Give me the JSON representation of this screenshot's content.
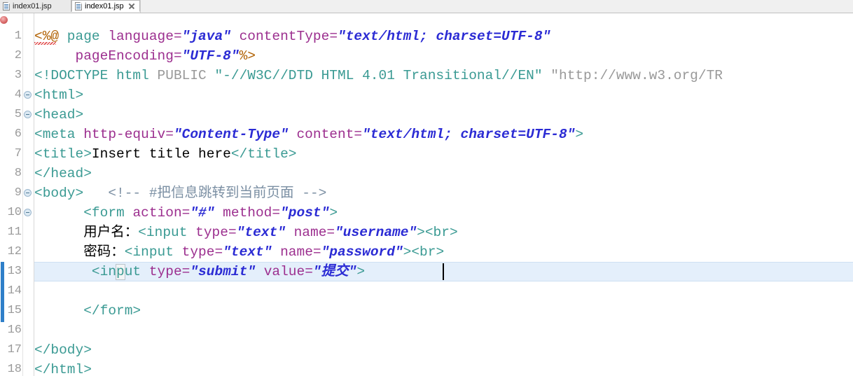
{
  "window": {
    "app": "Eclipse JSP Editor"
  },
  "tabs": [
    {
      "label": "index01.jsp",
      "active": false,
      "icon": "jsp-file-icon",
      "closable": false
    },
    {
      "label": "index01.jsp",
      "active": true,
      "icon": "jsp-file-icon",
      "closable": true
    }
  ],
  "editor": {
    "language": "jsp",
    "current_line": 13,
    "caret_line": 13,
    "total_lines": 18,
    "error_marker_line": 1,
    "colors": {
      "tag": "#3a9a93",
      "attribute": "#9c2f8f",
      "value": "#2b2bd4",
      "directive": "#b06000",
      "comment": "#7b8fa3",
      "doctype": "#999999",
      "text": "#000000",
      "line_number": "#9a9a9a",
      "current_line_highlight": "#e4effb",
      "change_bar": "#2f7fc9"
    },
    "fold_lines": [
      4,
      5,
      9,
      10
    ],
    "line_numbers": [
      "1",
      "2",
      "3",
      "4",
      "5",
      "6",
      "7",
      "8",
      "9",
      "10",
      "11",
      "12",
      "13",
      "14",
      "15",
      "16",
      "17",
      "18"
    ],
    "lines": [
      {
        "n": 1,
        "text": "<%@ page language=\"java\" contentType=\"text/html; charset=UTF-8\""
      },
      {
        "n": 2,
        "text": "    pageEncoding=\"UTF-8\"%>"
      },
      {
        "n": 3,
        "text": "<!DOCTYPE html PUBLIC \"-//W3C//DTD HTML 4.01 Transitional//EN\" \"http://www.w3.org/TR"
      },
      {
        "n": 4,
        "text": "<html>"
      },
      {
        "n": 5,
        "text": "<head>"
      },
      {
        "n": 6,
        "text": "<meta http-equiv=\"Content-Type\" content=\"text/html; charset=UTF-8\">"
      },
      {
        "n": 7,
        "text": "<title>Insert title here</title>"
      },
      {
        "n": 8,
        "text": "</head>"
      },
      {
        "n": 9,
        "text": "<body>   <!-- #把信息跳转到当前页面 -->"
      },
      {
        "n": 10,
        "text": "        <form action=\"#\" method=\"post\">"
      },
      {
        "n": 11,
        "text": "        用户名：<input type=\"text\" name=\"username\"><br>"
      },
      {
        "n": 12,
        "text": "        密码：<input type=\"text\" name=\"password\"><br>"
      },
      {
        "n": 13,
        "text": "         <input type=\"submit\" value=\"提交\">"
      },
      {
        "n": 14,
        "text": ""
      },
      {
        "n": 15,
        "text": "        </form>"
      },
      {
        "n": 16,
        "text": ""
      },
      {
        "n": 17,
        "text": "</body>"
      },
      {
        "n": 18,
        "text": "</html>"
      }
    ],
    "tokens": {
      "l1": {
        "directive_open": "<%@",
        "kw_page": " page ",
        "attr_language": "language",
        "eq1": "=",
        "val_java": "\"java\"",
        "sp1": " ",
        "attr_contentType": "contentType",
        "eq2": "=",
        "val_contentType": "\"text/html; charset=UTF-8\""
      },
      "l2": {
        "indent": "     ",
        "attr_pageEncoding": "pageEncoding",
        "eq": "=",
        "val_utf8": "\"UTF-8\"",
        "directive_close": "%>"
      },
      "l3": {
        "open": "<!DOCTYPE ",
        "kw_html": "html",
        "public": " PUBLIC ",
        "dtd": "\"-//W3C//DTD HTML 4.01 Transitional//EN\"",
        "space": " ",
        "url": "\"http://www.w3.org/TR"
      },
      "l4": {
        "tag": "<html>"
      },
      "l5": {
        "tag": "<head>"
      },
      "l6": {
        "open": "<meta ",
        "attr_httpequiv": "http-equiv",
        "eq1": "=",
        "val_contenttype": "\"Content-Type\"",
        "sp": " ",
        "attr_content": "content",
        "eq2": "=",
        "val_texthtml": "\"text/html; charset=UTF-8\"",
        "close": ">"
      },
      "l7": {
        "open": "<title>",
        "text": "Insert title here",
        "close": "</title>"
      },
      "l8": {
        "tag": "</head>"
      },
      "l9": {
        "tag": "<body>",
        "gap": "   ",
        "comment": "<!-- #把信息跳转到当前页面 -->"
      },
      "l10": {
        "indent": "      ",
        "open": "<form ",
        "attr_action": "action",
        "eq1": "=",
        "val_hash": "\"#\"",
        "sp": " ",
        "attr_method": "method",
        "eq2": "=",
        "val_post": "\"post\"",
        "close": ">"
      },
      "l11": {
        "indent": "      ",
        "label": "用户名：",
        "open": "<input ",
        "attr_type": "type",
        "eq1": "=",
        "val_text": "\"text\"",
        "sp": " ",
        "attr_name": "name",
        "eq2": "=",
        "val_username": "\"username\"",
        "close": ">",
        "br": "<br>"
      },
      "l12": {
        "indent": "      ",
        "label": "密码：",
        "open": "<input ",
        "attr_type": "type",
        "eq1": "=",
        "val_text": "\"text\"",
        "sp": " ",
        "attr_name": "name",
        "eq2": "=",
        "val_password": "\"password\"",
        "close": ">",
        "br": "<br>"
      },
      "l13": {
        "indent": "       ",
        "lt": "<",
        "tagname": "input ",
        "attr_type": "type",
        "eq1": "=",
        "val_submit": "\"submit\"",
        "sp": " ",
        "attr_value": "value",
        "eq2": "=",
        "val_tijiao": "\"提交\"",
        "close": ">"
      },
      "l15": {
        "indent": "      ",
        "tag": "</form>"
      },
      "l17": {
        "tag": "</body>"
      },
      "l18": {
        "tag": "</html>"
      }
    }
  }
}
